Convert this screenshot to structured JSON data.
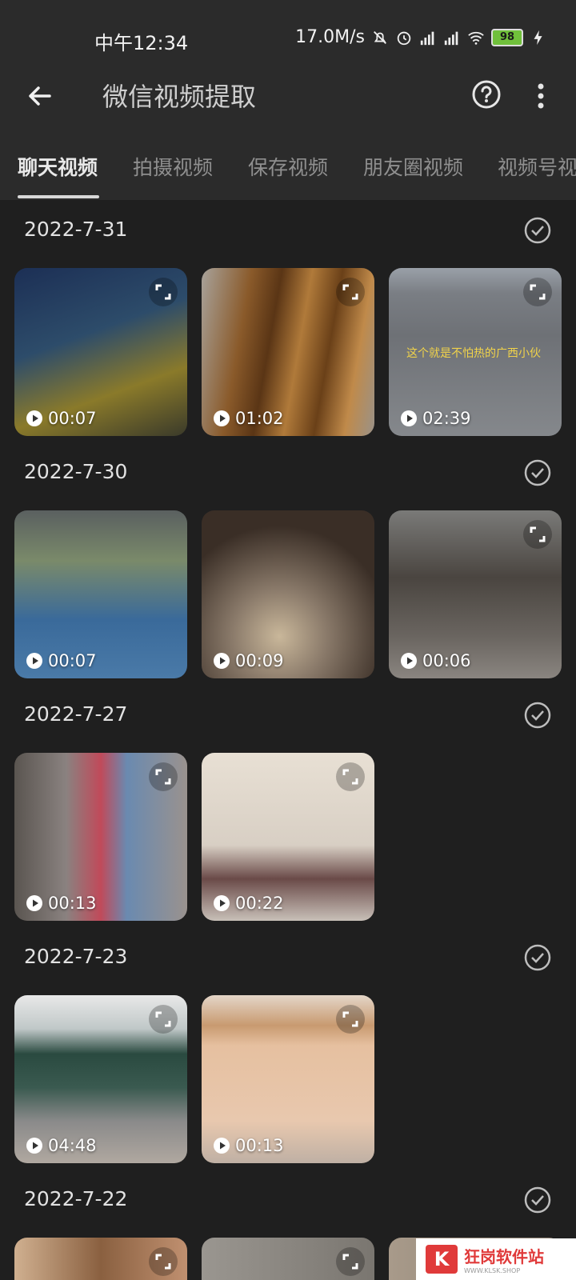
{
  "status_bar": {
    "time": "中午12:34",
    "net_speed": "17.0M/s",
    "battery": "98",
    "icons": [
      "mute-icon",
      "alarm-icon",
      "signal-icon",
      "hd-signal-icon",
      "wifi-icon",
      "charging-icon"
    ]
  },
  "app_bar": {
    "title": "微信视频提取",
    "icons": [
      "back-arrow-icon",
      "help-icon",
      "more-vert-icon"
    ]
  },
  "tabs": [
    {
      "label": "聊天视频",
      "active": true
    },
    {
      "label": "拍摄视频",
      "active": false
    },
    {
      "label": "保存视频",
      "active": false
    },
    {
      "label": "朋友圈视频",
      "active": false
    },
    {
      "label": "视频号视",
      "active": false
    }
  ],
  "groups": [
    {
      "date": "2022-7-31",
      "videos": [
        {
          "duration": "00:07",
          "color": "#2f4a6b"
        },
        {
          "duration": "01:02",
          "color": "#7a4a1f"
        },
        {
          "duration": "02:39",
          "color": "#6b6e72",
          "caption": "这个就是不怕热的广西小伙"
        }
      ]
    },
    {
      "date": "2022-7-30",
      "videos": [
        {
          "duration": "00:07",
          "color": "#5a6f7f"
        },
        {
          "duration": "00:09",
          "color": "#6d5b4a"
        },
        {
          "duration": "00:06",
          "color": "#5c5a55"
        }
      ]
    },
    {
      "date": "2022-7-27",
      "videos": [
        {
          "duration": "00:13",
          "color": "#7b7275"
        },
        {
          "duration": "00:22",
          "color": "#c9bfb4"
        }
      ]
    },
    {
      "date": "2022-7-23",
      "videos": [
        {
          "duration": "04:48",
          "color": "#6e7a70"
        },
        {
          "duration": "00:13",
          "color": "#d8b9a0"
        }
      ]
    },
    {
      "date": "2022-7-22",
      "videos": [
        {
          "color": "#b38a66"
        },
        {
          "color": "#8a8a86"
        },
        {
          "color": "#9b8e80"
        }
      ]
    }
  ],
  "watermark": {
    "logo": "K",
    "name": "狂岗软件站",
    "sub": "WWW.KLSK.SHOP"
  }
}
